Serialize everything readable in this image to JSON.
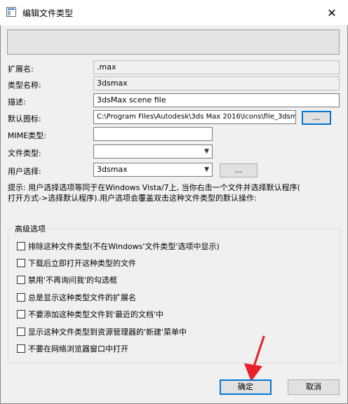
{
  "window": {
    "title": "编辑文件类型",
    "close_glyph": "✕"
  },
  "fields": {
    "extension_label": "扩展名:",
    "extension_value": ".max",
    "type_name_label": "类型名称:",
    "type_name_value": "3dsmax",
    "description_label": "描述:",
    "description_value": "3dsMax scene file",
    "default_icon_label": "默认图标:",
    "default_icon_value": "C:\\Program Files\\Autodesk\\3ds Max 2016\\Icons\\file_3dsma",
    "default_icon_browse": "...",
    "mime_label": "MIME类型:",
    "mime_value": "",
    "file_type_label": "文件类型:",
    "file_type_value": "",
    "user_choice_label": "用户选择:",
    "user_choice_value": "3dsmax",
    "user_choice_browse": "..."
  },
  "tip": {
    "line1": "提示: 用户选择选项等同于在Windows Vista/7上, 当你右击一个文件并选择默认程序(",
    "line2": "打开方式->选择默认程序).用户选项会覆盖双击这种文件类型的默认操作:"
  },
  "advanced": {
    "title": "高级选项",
    "options": [
      {
        "label": "排除这种文件类型(不在Windows'文件类型'选项中显示)",
        "checked": false
      },
      {
        "label": "下载后立即打开这种类型的文件",
        "checked": false
      },
      {
        "label": "禁用'不再询问我'的勾选框",
        "checked": false
      },
      {
        "label": "总是显示这种类型文件的扩展名",
        "checked": false
      },
      {
        "label": "不要添加这种类型文件到'最近的文档'中",
        "checked": false
      },
      {
        "label": "显示这种文件类型到资源管理器的'新建'菜单中",
        "checked": false
      },
      {
        "label": "不要在网络浏览器窗口中打开",
        "checked": false
      }
    ]
  },
  "buttons": {
    "ok": "确定",
    "cancel": "取消"
  },
  "colors": {
    "accent": "#0078d7",
    "annotation_arrow": "#e8202a"
  },
  "icons": {
    "app": "window-icon",
    "close": "close-icon",
    "dropdown": "chevron-down-icon",
    "annotation": "red-arrow-icon"
  }
}
